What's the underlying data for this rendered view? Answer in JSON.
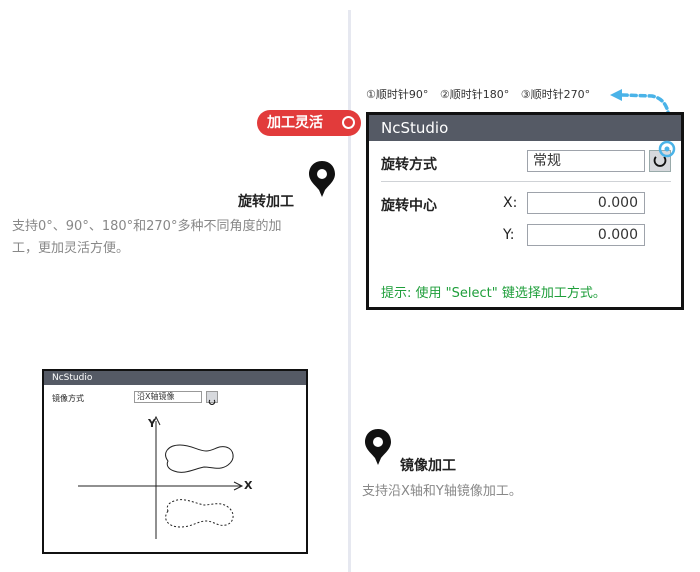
{
  "rotation": {
    "title": "旋转加工",
    "description_line1": "支持0°、90°、180°和270°多种不同角度的加",
    "description_line2": "工，更加灵活方便。",
    "badge": "加工灵活",
    "options": [
      "①顺时针90°",
      "②顺时针180°",
      "③顺时针270°"
    ]
  },
  "ncstudio_window": {
    "title": "NcStudio",
    "rotation_mode_label": "旋转方式",
    "rotation_mode_value": "常规",
    "rotation_center_label": "旋转中心",
    "x_label": "X:",
    "x_value": "0.000",
    "y_label": "Y:",
    "y_value": "0.000",
    "hint": "提示: 使用 \"Select\" 键选择加工方式。"
  },
  "mirror_window": {
    "title": "NcStudio",
    "mode_label": "镜像方式",
    "mode_value": "沿X轴镜像",
    "axis_y": "Y",
    "axis_x": "X"
  },
  "mirror": {
    "title": "镜像加工",
    "description": "支持沿X轴和Y轴镜像加工。"
  },
  "colors": {
    "badge": "#e23b3b",
    "arrow": "#4ab3e8",
    "hint": "#1e9e3a",
    "titlebar": "#555a65"
  }
}
